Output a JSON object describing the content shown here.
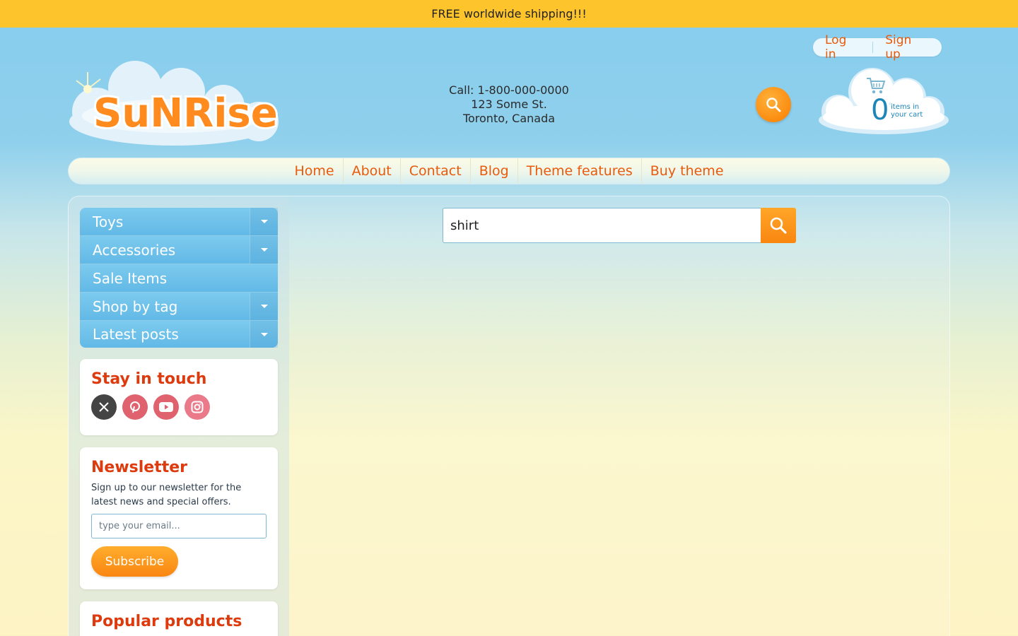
{
  "announcement": "FREE worldwide shipping!!!",
  "account": {
    "login": "Log in",
    "signup": "Sign up"
  },
  "logo": {
    "text": "SuNRise"
  },
  "contact": {
    "phone": "Call: 1-800-000-0000",
    "address1": "123 Some St.",
    "address2": "Toronto, Canada"
  },
  "cart": {
    "count": "0",
    "label_line1": "items in",
    "label_line2": "your cart"
  },
  "nav": [
    "Home",
    "About",
    "Contact",
    "Blog",
    "Theme features",
    "Buy theme"
  ],
  "sidebar": {
    "menu": [
      {
        "label": "Toys",
        "expandable": true
      },
      {
        "label": "Accessories",
        "expandable": true
      },
      {
        "label": "Sale Items",
        "expandable": false
      },
      {
        "label": "Shop by tag",
        "expandable": true
      },
      {
        "label": "Latest posts",
        "expandable": true
      }
    ],
    "stay_in_touch": {
      "title": "Stay in touch",
      "icons": [
        "x-icon",
        "pinterest-icon",
        "youtube-icon",
        "instagram-icon"
      ]
    },
    "newsletter": {
      "title": "Newsletter",
      "text": "Sign up to our newsletter for the latest news and special offers.",
      "placeholder": "type your email...",
      "button": "Subscribe"
    },
    "popular": {
      "title": "Popular products"
    }
  },
  "search": {
    "value": "shirt"
  },
  "colors": {
    "accent": "#e85a0c",
    "topbar": "#fec42c",
    "menu": "#6cbfe9",
    "heading": "#dd3a0e"
  }
}
